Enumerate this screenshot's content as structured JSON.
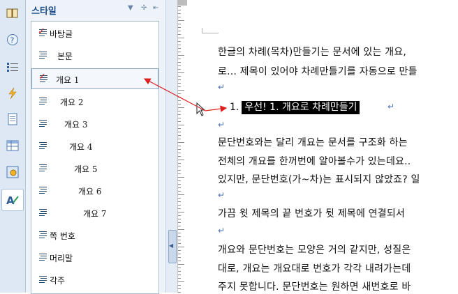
{
  "toolbar": {
    "icons": [
      "book-icon",
      "help-icon",
      "numbered-list-icon",
      "lightning-icon",
      "page-icon",
      "table-icon",
      "settings-icon",
      "style-icon"
    ]
  },
  "panel": {
    "title": "스타일",
    "items": [
      {
        "label": "바탕글",
        "checked": true
      },
      {
        "label": "본문",
        "checked": false
      },
      {
        "label": "개요 1",
        "checked": true,
        "selected": true
      },
      {
        "label": "개요 2",
        "checked": false
      },
      {
        "label": "개요 3",
        "checked": false
      },
      {
        "label": "개요 4",
        "checked": false
      },
      {
        "label": "개요 5",
        "checked": false
      },
      {
        "label": "개요 6",
        "checked": false
      },
      {
        "label": "개요 7",
        "checked": false
      },
      {
        "label": "쪽 번호",
        "checked": false
      },
      {
        "label": "머리말",
        "checked": false
      },
      {
        "label": "각주",
        "checked": false
      }
    ]
  },
  "document": {
    "lines": [
      "한글의 차례(목차)만들기는 문서에 있는 개요,",
      "로... 제목이 있어야 차례만들기를 자동으로 만들",
      "",
      "",
      "문단번호와는 달리 개요는 문서를 구조화 하는",
      "전체의 개요를 한꺼번에 알아볼수가 있는데요..",
      "있지만, 문단번호(가~차)는 표시되지 않았죠? 일",
      "",
      "가끔 윗 제목의 끝 번호가 뒷 제목에 연결되서",
      "",
      "개요와 문단번호는 모양은 거의 같지만, 성질은",
      "대로, 개요는 개요대로 번호가 각각 내려가는데",
      "주지 못합니다. 문단번호는 원하면 새번호로 바"
    ],
    "heading_number": "1.",
    "heading_text": "우선! 1. 개요로 차례만들기",
    "paragraph_mark": "↵"
  },
  "colors": {
    "accent": "#1d4d86",
    "arrow": "#e02020",
    "selection": "#000000"
  }
}
